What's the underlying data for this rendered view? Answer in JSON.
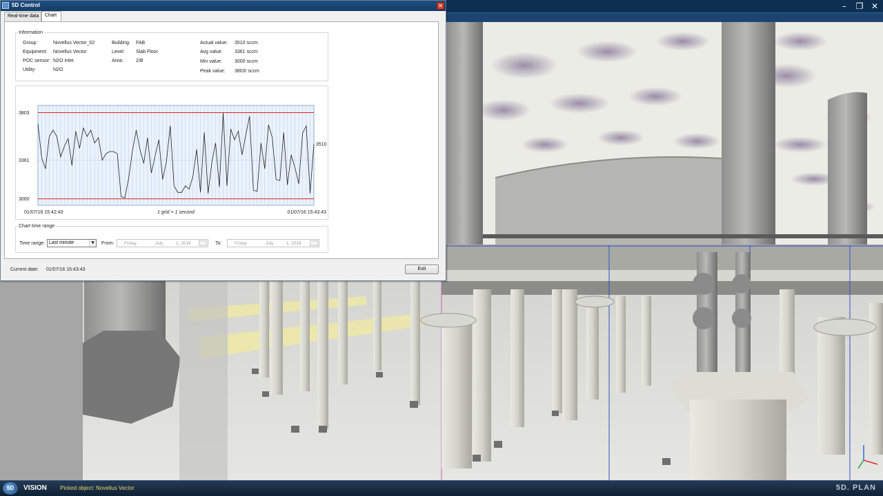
{
  "dialog": {
    "title": "5D Control",
    "tabs": [
      {
        "label": "Real-time data",
        "active": false
      },
      {
        "label": "Chart",
        "active": true
      }
    ],
    "info": {
      "legend": "Information",
      "group_label": "Group:",
      "group_value": "Novellus Vector_02",
      "equipment_label": "Equipment:",
      "equipment_value": "Novellus Vector",
      "poc_label": "POC sensor:",
      "poc_value": "N2O Inlet",
      "utility_label": "Utility:",
      "utility_value": "N2O",
      "building_label": "Building:",
      "building_value": "FAB",
      "level_label": "Level:",
      "level_value": "Slab Floor",
      "area_label": "Area:",
      "area_value": "2/B",
      "actual_label": "Actual value:",
      "actual_value": "3510 sccm",
      "avg_label": "Avg value:",
      "avg_value": "3361 sccm",
      "min_label": "Min value:",
      "min_value": "3000 sccm",
      "peak_label": "Peak value:",
      "peak_value": "3803! sccm"
    },
    "time_range": {
      "legend": "Chart time range",
      "range_label": "Time range:",
      "range_value": "Last minute",
      "from_label": "From:",
      "to_label": "To:",
      "from_date": {
        "day": "Friday",
        "month": "July",
        "date": "1, 2016"
      },
      "to_date": {
        "day": "Friday",
        "month": "July",
        "date": "1, 2016"
      }
    },
    "current_date_label": "Current date:",
    "current_date_value": "01/07/16 15:43:43",
    "exit_label": "Exit"
  },
  "chart_data": {
    "type": "line",
    "x_start_label": "01/07/16 15:42:43",
    "x_end_label": "01/07/16 15:43:43",
    "grid_note": "1 grid = 1 second",
    "y_ticks": [
      3000,
      3361,
      3803
    ],
    "reference_lines": [
      3803,
      3000
    ],
    "ylim": [
      2940,
      3870
    ],
    "last_value_label": "3510",
    "grid": true,
    "series": [
      {
        "values": [
          3700,
          3380,
          3280,
          3580,
          3640,
          3580,
          3390,
          3490,
          3560,
          3310,
          3630,
          3470,
          3660,
          3580,
          3640,
          3520,
          3570,
          3360,
          3420,
          3440,
          3440,
          3420,
          3020,
          3010,
          3190,
          3450,
          3640,
          3460,
          3330,
          3570,
          3240,
          3400,
          3550,
          3180,
          3350,
          3680,
          3120,
          3060,
          3060,
          3120,
          3090,
          3210,
          3460,
          3060,
          3620,
          3050,
          3340,
          3520,
          3110,
          3800,
          3120,
          3650,
          3550,
          3630,
          3410,
          3600,
          3770,
          3080,
          3070,
          3520,
          3280,
          3690,
          3570,
          3180,
          3170,
          3620,
          3130,
          3410,
          3290,
          3140,
          3610,
          3680,
          3050,
          3510
        ]
      }
    ]
  },
  "app": {
    "minimize_icon": "minimize-icon",
    "restore_icon": "restore-icon",
    "close_icon": "close-icon"
  },
  "statusbar": {
    "logo_text": "5D",
    "app_name": "VISION",
    "picked_object": "Picked object: Novellus Vector",
    "brand": "5D. PLAN"
  }
}
